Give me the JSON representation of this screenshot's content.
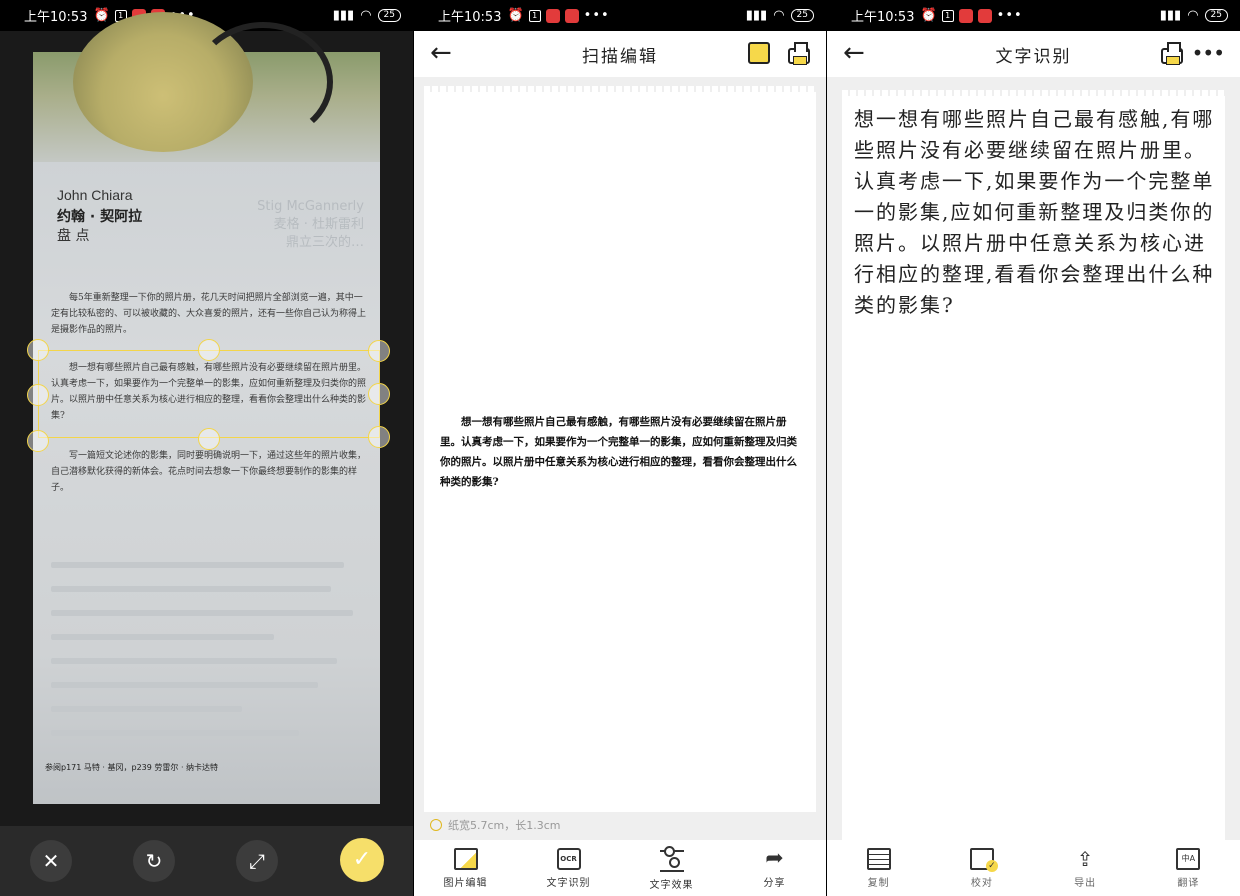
{
  "status": {
    "time": "上午10:53",
    "battery": "25"
  },
  "panel1": {
    "photo": {
      "author_en": "John Chiara",
      "author_cn": "约翰 · 契阿拉",
      "section": "盘 点",
      "ghost_text": [
        "Stig McGannerly",
        "麦格 · 杜斯雷利",
        "鼎立三次的…"
      ],
      "para1": "每5年重新整理一下你的照片册，花几天时间把照片全部浏览一遍，其中一定有比较私密的、可以被收藏的、大众喜爱的照片，还有一些你自己认为称得上是摄影作品的照片。",
      "para2": "想一想有哪些照片自己最有感触，有哪些照片没有必要继续留在照片册里。认真考虑一下，如果要作为一个完整单一的影集，应如何重新整理及归类你的照片。以照片册中任意关系为核心进行相应的整理，看看你会整理出什么种类的影集?",
      "para3": "写一篇短文论述你的影集，同时要明确说明一下，通过这些年的照片收集，自己潜移默化获得的新体会。花点时间去想象一下你最终想要制作的影集的样子。",
      "footer": "参阅p171 马特 · 基冈，p239 劳雷尔 · 纳卡达特"
    },
    "buttons": {
      "cancel": "✕",
      "rotate": "↻",
      "expand": "⤢",
      "confirm": "✓"
    }
  },
  "panel2": {
    "title": "扫描编辑",
    "ocr_snippet": "想一想有哪些照片自己最有感触，有哪些照片没有必要继续留在照片册里。认真考虑一下，如果要作为一个完整单一的影集，应如何重新整理及归类你的照片。以照片册中任意关系为核心进行相应的整理，看看你会整理出什么种类的影集?",
    "tip": "纸宽5.7cm，长1.3cm",
    "tools": [
      {
        "label": "图片编辑",
        "icon": "crop-icon"
      },
      {
        "label": "文字识别",
        "icon": "ocr-icon"
      },
      {
        "label": "文字效果",
        "icon": "sliders-icon"
      },
      {
        "label": "分享",
        "icon": "share-icon"
      }
    ]
  },
  "panel3": {
    "title": "文字识别",
    "text": "想一想有哪些照片自己最有感触,有哪些照片没有必要继续留在照片册里。认真考虑一下,如果要作为一个完整单一的影集,应如何重新整理及归类你的照片。以照片册中任意关系为核心进行相应的整理,看看你会整理出什么种类的影集?",
    "tools": [
      {
        "label": "复制",
        "icon": "copy-icon"
      },
      {
        "label": "校对",
        "icon": "proofread-icon"
      },
      {
        "label": "导出",
        "icon": "export-icon"
      },
      {
        "label": "翻译",
        "icon": "translate-icon"
      }
    ]
  },
  "colors": {
    "accent": "#f6d84a",
    "crop_line": "#f3d54a",
    "dark_bar": "#2a2a2a"
  }
}
